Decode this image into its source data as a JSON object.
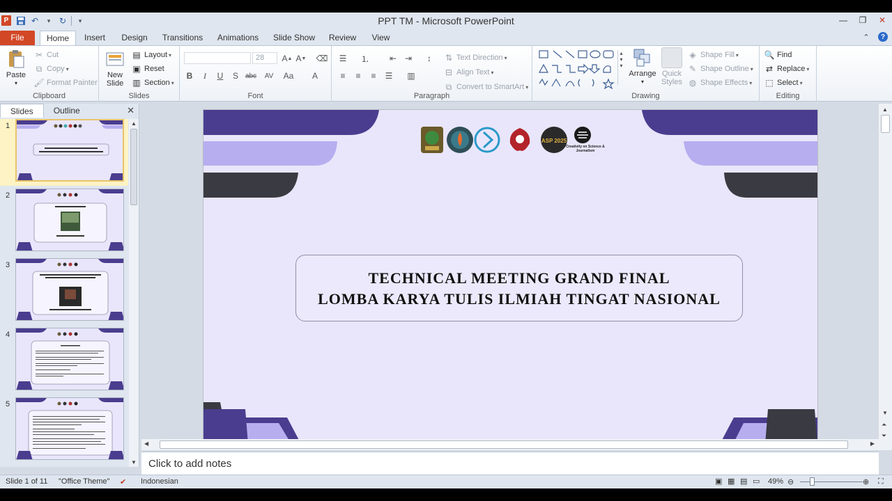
{
  "app": {
    "title": "PPT TM - Microsoft PowerPoint",
    "logo_letter": "P"
  },
  "tabs": [
    "File",
    "Home",
    "Insert",
    "Design",
    "Transitions",
    "Animations",
    "Slide Show",
    "Review",
    "View"
  ],
  "ribbon": {
    "clipboard": {
      "paste": "Paste",
      "cut": "Cut",
      "copy": "Copy",
      "format_painter": "Format Painter",
      "label": "Clipboard"
    },
    "slides": {
      "new_slide": "New Slide",
      "layout": "Layout",
      "reset": "Reset",
      "section": "Section",
      "label": "Slides"
    },
    "font": {
      "font_size": "28",
      "label": "Font"
    },
    "paragraph": {
      "text_direction": "Text Direction",
      "align_text": "Align Text",
      "convert_smartart": "Convert to SmartArt",
      "label": "Paragraph"
    },
    "drawing": {
      "arrange": "Arrange",
      "quick_styles": "Quick Styles",
      "shape_fill": "Shape Fill",
      "shape_outline": "Shape Outline",
      "shape_effects": "Shape Effects",
      "label": "Drawing"
    },
    "editing": {
      "find": "Find",
      "replace": "Replace",
      "select": "Select",
      "label": "Editing"
    }
  },
  "left_pane": {
    "tabs": [
      "Slides",
      "Outline"
    ],
    "thumbnails": [
      {
        "number": "1",
        "text": "TECHNICAL MEETING GRAND FINAL LOMBA KARYA TULIS ILMIAH TINGAT NASIONAL"
      },
      {
        "number": "2",
        "text": ""
      },
      {
        "number": "3",
        "text": ""
      },
      {
        "number": "4",
        "text": ""
      },
      {
        "number": "5",
        "text": ""
      }
    ]
  },
  "slide": {
    "title_line1": "TECHNICAL MEETING GRAND FINAL",
    "title_line2": "LOMBA KARYA TULIS ILMIAH TINGAT  NASIONAL",
    "logo_caption": "Creativity on Science & Journalism",
    "logo_badge_text": "ASP 2025"
  },
  "notes": {
    "placeholder": "Click to add notes"
  },
  "status": {
    "slide_info": "Slide 1 of 11",
    "theme": "\"Office Theme\"",
    "language": "Indonesian",
    "zoom": "49%"
  },
  "colors": {
    "accent_purple": "#4a3d8f",
    "light_purple": "#b7aef0",
    "dark_gray": "#3a3a42",
    "slide_bg": "#e9e6fb",
    "file_tab": "#d24726"
  }
}
